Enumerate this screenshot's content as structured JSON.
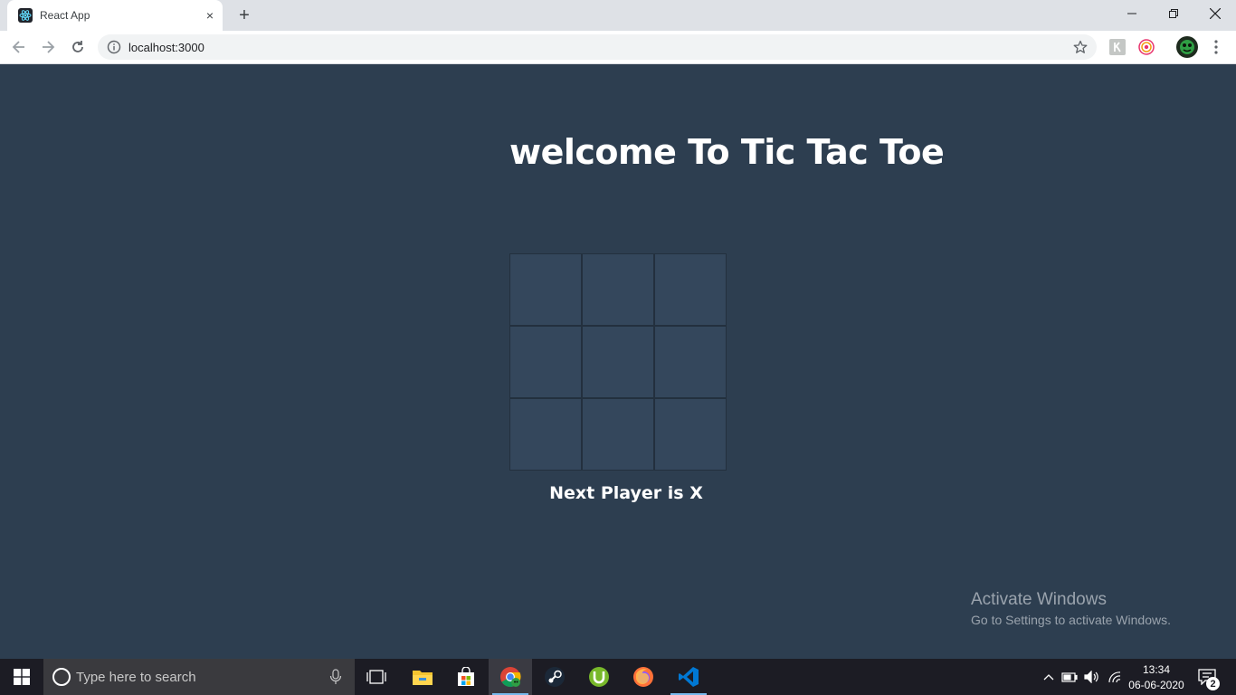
{
  "browser": {
    "tab": {
      "title": "React App",
      "favicon": "react-logo-icon",
      "close": "×"
    },
    "new_tab": "+",
    "window_controls": [
      "minimize-icon",
      "restore-icon",
      "close-icon"
    ],
    "url": "localhost:3000",
    "extensions": [
      "extension-k-icon",
      "extension-target-icon",
      "profile-avatar"
    ]
  },
  "page": {
    "title": "welcome To Tic Tac Toe",
    "board": {
      "cells": [
        "",
        "",
        "",
        "",
        "",
        "",
        "",
        "",
        ""
      ]
    },
    "status": "Next Player is X"
  },
  "watermark": {
    "title": "Activate Windows",
    "subtitle": "Go to Settings to activate Windows."
  },
  "taskbar": {
    "search_placeholder": "Type here to search",
    "apps": [
      "task-view-icon",
      "file-explorer-icon",
      "store-icon",
      "chrome-icon",
      "steam-icon",
      "utorrent-icon",
      "firefox-icon",
      "vscode-icon"
    ],
    "clock_time": "13:34",
    "clock_date": "06-06-2020",
    "notification_count": "2"
  },
  "colors": {
    "page_background": "#2d3e50",
    "cell_background": "#34475c",
    "cell_border": "#23303e",
    "text": "#ffffff"
  }
}
